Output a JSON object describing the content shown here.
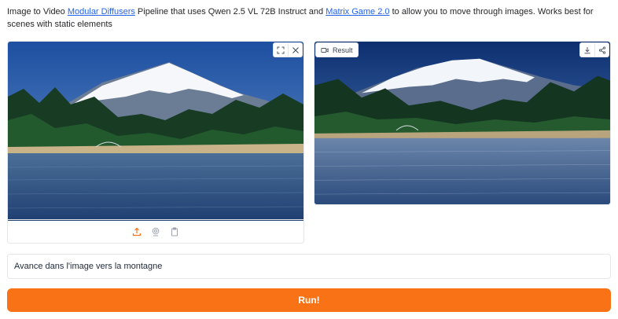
{
  "description": {
    "part1": "Image to Video ",
    "link1": "Modular Diffusers",
    "part2": " Pipeline that uses Qwen 2.5 VL 72B Instruct and ",
    "link2": "Matrix Game 2.0",
    "part3": " to allow you to move through images. Works best for scenes with static elements"
  },
  "input_image": {
    "icons": [
      "fullscreen-icon",
      "close-icon"
    ],
    "sources": [
      "upload-icon",
      "webcam-icon",
      "clipboard-icon"
    ]
  },
  "output_video": {
    "label": "Result",
    "label_icon": "video-icon",
    "icons": [
      "download-icon",
      "share-icon"
    ]
  },
  "prompt": {
    "value": "Avance dans l'image vers la montagne"
  },
  "run_button": {
    "label": "Run!"
  },
  "colors": {
    "accent": "#f97316",
    "link": "#2563eb"
  }
}
